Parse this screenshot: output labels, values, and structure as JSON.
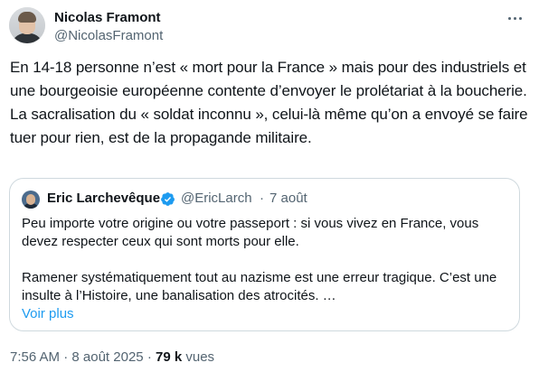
{
  "author": {
    "name": "Nicolas Framont",
    "handle": "@NicolasFramont"
  },
  "tweet": {
    "paragraph1": "En 14-18 personne n’est « mort pour la France » mais pour des industriels et une bourgeoisie européenne contente d’envoyer le prolétariat à la boucherie.",
    "paragraph2": "La sacralisation du « soldat inconnu », celui-là même qu’on a envoyé se faire tuer pour rien, est de la propagande militaire."
  },
  "quoted": {
    "name": "Eric Larchevêque",
    "verified_icon": "verified-badge-icon",
    "handle": "@EricLarch",
    "separator": "·",
    "date": "7 août",
    "paragraph1": "Peu importe votre origine ou votre passeport : si vous vivez en France, vous devez respecter ceux qui sont morts pour elle.",
    "paragraph2": "Ramener systématiquement tout au nazisme est une erreur tragique. C’est une insulte à l’Histoire, une banalisation des atrocités. …",
    "show_more": "Voir plus"
  },
  "meta": {
    "time": "7:56 AM",
    "separator": "·",
    "date": "8 août 2025",
    "views_count": "79 k",
    "views_label": "vues"
  },
  "colors": {
    "text": "#0f1419",
    "secondary": "#536471",
    "link": "#1d9bf0",
    "border": "#cfd9de",
    "verified": "#1d9bf0"
  },
  "icons": {
    "more": "more-options-icon"
  }
}
